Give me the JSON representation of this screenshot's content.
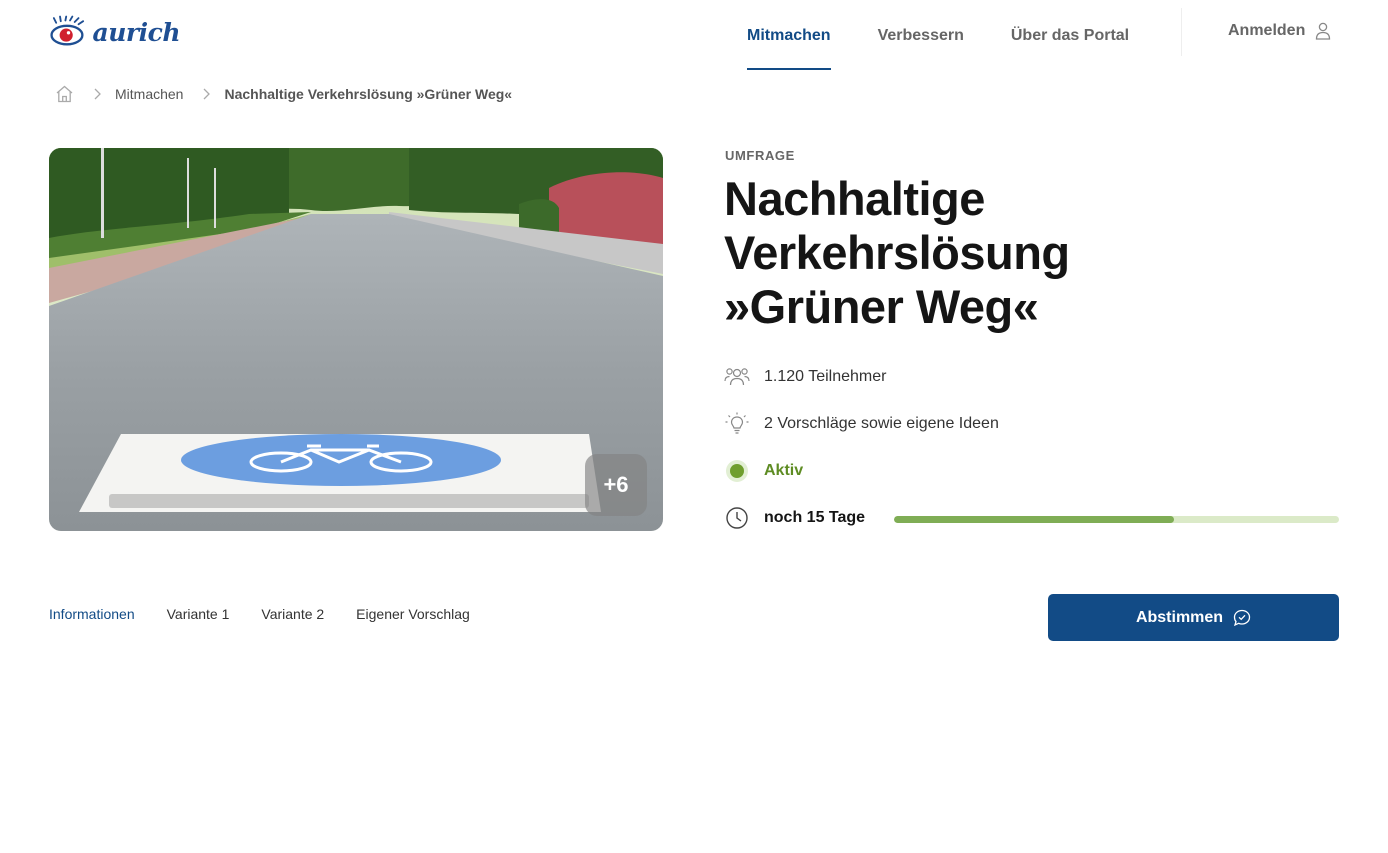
{
  "brand": {
    "name": "aurich"
  },
  "nav": {
    "items": [
      {
        "label": "Mitmachen",
        "active": true
      },
      {
        "label": "Verbessern",
        "active": false
      },
      {
        "label": "Über das Portal",
        "active": false
      }
    ],
    "login_label": "Anmelden"
  },
  "breadcrumb": {
    "home_icon": "home-icon",
    "items": [
      "Mitmachen",
      "Nachhaltige Verkehrslösung »Grüner Weg«"
    ]
  },
  "hero": {
    "more_count": "+6"
  },
  "project": {
    "kicker": "UMFRAGE",
    "title_lines": [
      "Nachhaltige",
      "Verkehrslösung",
      "»Grüner Weg«"
    ],
    "participants": "1.120 Teilnehmer",
    "proposals": "2 Vorschläge sowie eigene Ideen",
    "status": "Aktiv",
    "remaining": "noch 15 Tage",
    "progress_fraction": 0.63
  },
  "tabs": [
    {
      "label": "Informationen",
      "active": true
    },
    {
      "label": "Variante 1",
      "active": false
    },
    {
      "label": "Variante 2",
      "active": false
    },
    {
      "label": "Eigener Vorschlag",
      "active": false
    }
  ],
  "vote_button": {
    "label": "Abstimmen"
  },
  "colors": {
    "primary": "#124b86",
    "status_green": "#5e8c23",
    "progress_fill": "#7fad55",
    "progress_track": "#dbeac8"
  }
}
